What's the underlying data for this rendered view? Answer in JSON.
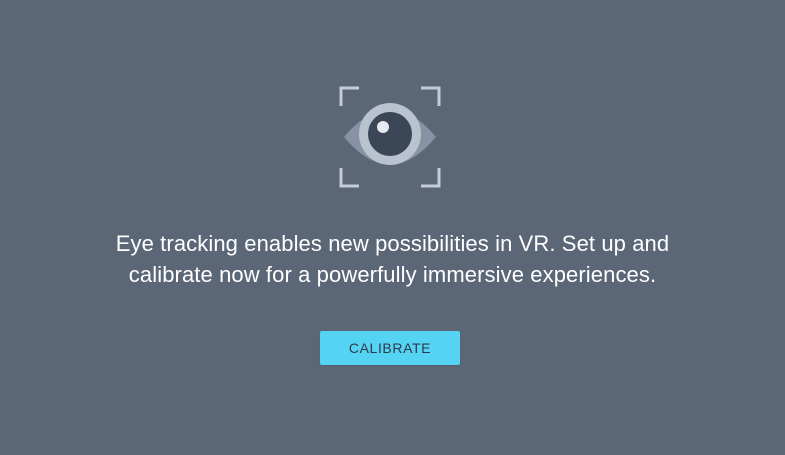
{
  "calibration": {
    "message_line1": "Eye tracking enables new possibilities in VR. Set up and",
    "message_line2": "calibrate now for a powerfully immersive experiences.",
    "button_label": "CALIBRATE"
  },
  "icons": {
    "main_graphic": "eye-tracking-icon"
  },
  "colors": {
    "background": "#5b6677",
    "accent": "#55d3f2",
    "text": "#ffffff"
  }
}
